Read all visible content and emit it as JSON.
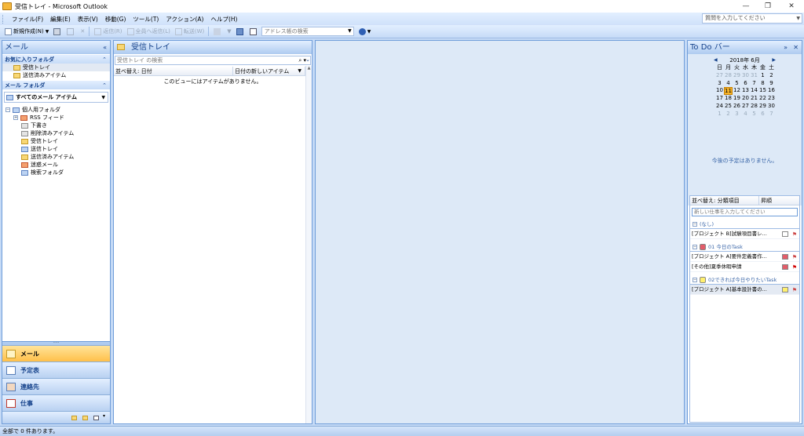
{
  "window": {
    "title": "受信トレイ - Microsoft Outlook",
    "minimize": "—",
    "restore": "❐",
    "close": "✕"
  },
  "menu": [
    "ファイル(F)",
    "編集(E)",
    "表示(V)",
    "移動(G)",
    "ツール(T)",
    "アクション(A)",
    "ヘルプ(H)"
  ],
  "help_box": {
    "placeholder": "質問を入力してください"
  },
  "toolbar": {
    "new": "新規作成(N)",
    "reply": "返信(R)",
    "reply_all": "全員へ返信(L)",
    "forward": "転送(W)",
    "address_placeholder": "アドレス帳の検索"
  },
  "nav": {
    "title": "メール",
    "favorites_header": "お気に入りフォルダ",
    "favorites": [
      "受信トレイ",
      "送信済みアイテム"
    ],
    "mail_folders_header": "メール フォルダ",
    "all_mail": "すべてのメール アイテム",
    "root": "個人用フォルダ",
    "folders": [
      "RSS フィード",
      "下書き",
      "削除済みアイテム",
      "受信トレイ",
      "送信トレイ",
      "送信済みアイテム",
      "迷惑メール",
      "検索フォルダ"
    ],
    "buttons": [
      "メール",
      "予定表",
      "連絡先",
      "仕事"
    ]
  },
  "list": {
    "title": "受信トレイ",
    "search_placeholder": "受信トレイ の検索",
    "arrange_by": "並べ替え: 日付",
    "order": "日付の新しいアイテム",
    "empty_text": "このビューにはアイテムがありません。"
  },
  "todo": {
    "title": "To Do バー",
    "calendar": {
      "month": "2018年 6月",
      "dow": [
        "日",
        "月",
        "火",
        "水",
        "木",
        "金",
        "土"
      ],
      "weeks": [
        [
          "27",
          "28",
          "29",
          "30",
          "31",
          "1",
          "2"
        ],
        [
          "3",
          "4",
          "5",
          "6",
          "7",
          "8",
          "9"
        ],
        [
          "10",
          "11",
          "12",
          "13",
          "14",
          "15",
          "16"
        ],
        [
          "17",
          "18",
          "19",
          "20",
          "21",
          "22",
          "23"
        ],
        [
          "24",
          "25",
          "26",
          "27",
          "28",
          "29",
          "30"
        ],
        [
          "1",
          "2",
          "3",
          "4",
          "5",
          "6",
          "7"
        ]
      ],
      "today": "11"
    },
    "no_appointments": "今後の予定はありません。",
    "tasks": {
      "arrange_by": "並べ替え: 分類項目",
      "order": "昇順",
      "input_placeholder": "新しい仕事を入力してください",
      "groups": [
        {
          "name": "(なし)",
          "color": "",
          "items": [
            "[プロジェクト B]試験項目書レ..."
          ]
        },
        {
          "name": "01 今日のTask",
          "color": "#e35d6a",
          "items": [
            "[プロジェクト A]要件定義書作...",
            "[その他]夏季休暇申請"
          ]
        },
        {
          "name": "02できれば今日やりたいTask",
          "color": "#fff06e",
          "items": [
            "[プロジェクト A]基本設計書の..."
          ]
        }
      ]
    }
  },
  "status": "全部で 0 件あります。"
}
